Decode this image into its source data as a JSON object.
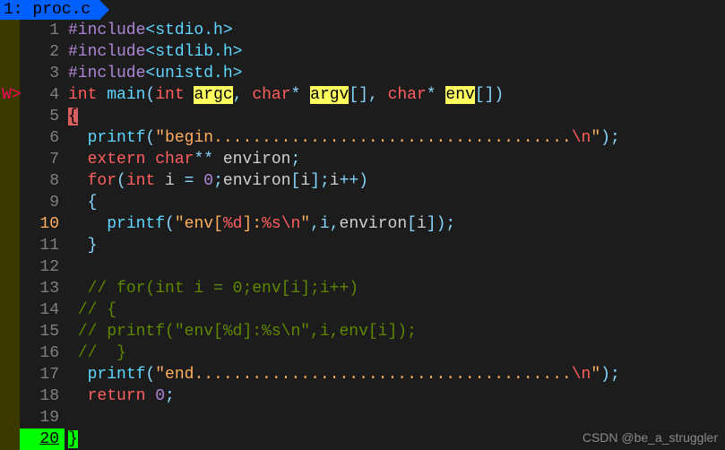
{
  "tab": {
    "label": "1: proc.c"
  },
  "sign": {
    "warn": "W>"
  },
  "watermark": "CSDN @be_a_struggler",
  "tok": {
    "include": "#include",
    "stdio": "<stdio.h>",
    "stdlib": "<stdlib.h>",
    "unistd": "<unistd.h>",
    "int": "int",
    "main": "main",
    "argc": "argc",
    "char": "char",
    "argv": "argv",
    "env": "env",
    "openbrace": "{",
    "closebrace": "}",
    "printf": "printf",
    "begin_str": "\"begin.....................................",
    "end_str": "\"end.......................................",
    "nl": "\\n",
    "qclose": "\"",
    "extern": "extern",
    "environ": "environ",
    "for": "for",
    "i": "i",
    "eq": " = ",
    "zero": "0",
    "envfmt_open": "\"env[",
    "pd": "%d",
    "envfmt_mid": "]:",
    "ps": "%s",
    "comma_i": ",i,",
    "cm_for": "// for(int i = 0;env[i];i++)",
    "cm_ob": "// {",
    "cm_pf": "// printf(\"env[%d]:%s\\n\",i,env[i]);",
    "cm_cb": "//  }",
    "return": "return",
    "semicolon": ";"
  },
  "lines": [
    "1",
    "2",
    "3",
    "4",
    "5",
    "6",
    "7",
    "8",
    "9",
    "10",
    "11",
    "12",
    "13",
    "14",
    "15",
    "16",
    "17",
    "18",
    "19",
    "20"
  ]
}
